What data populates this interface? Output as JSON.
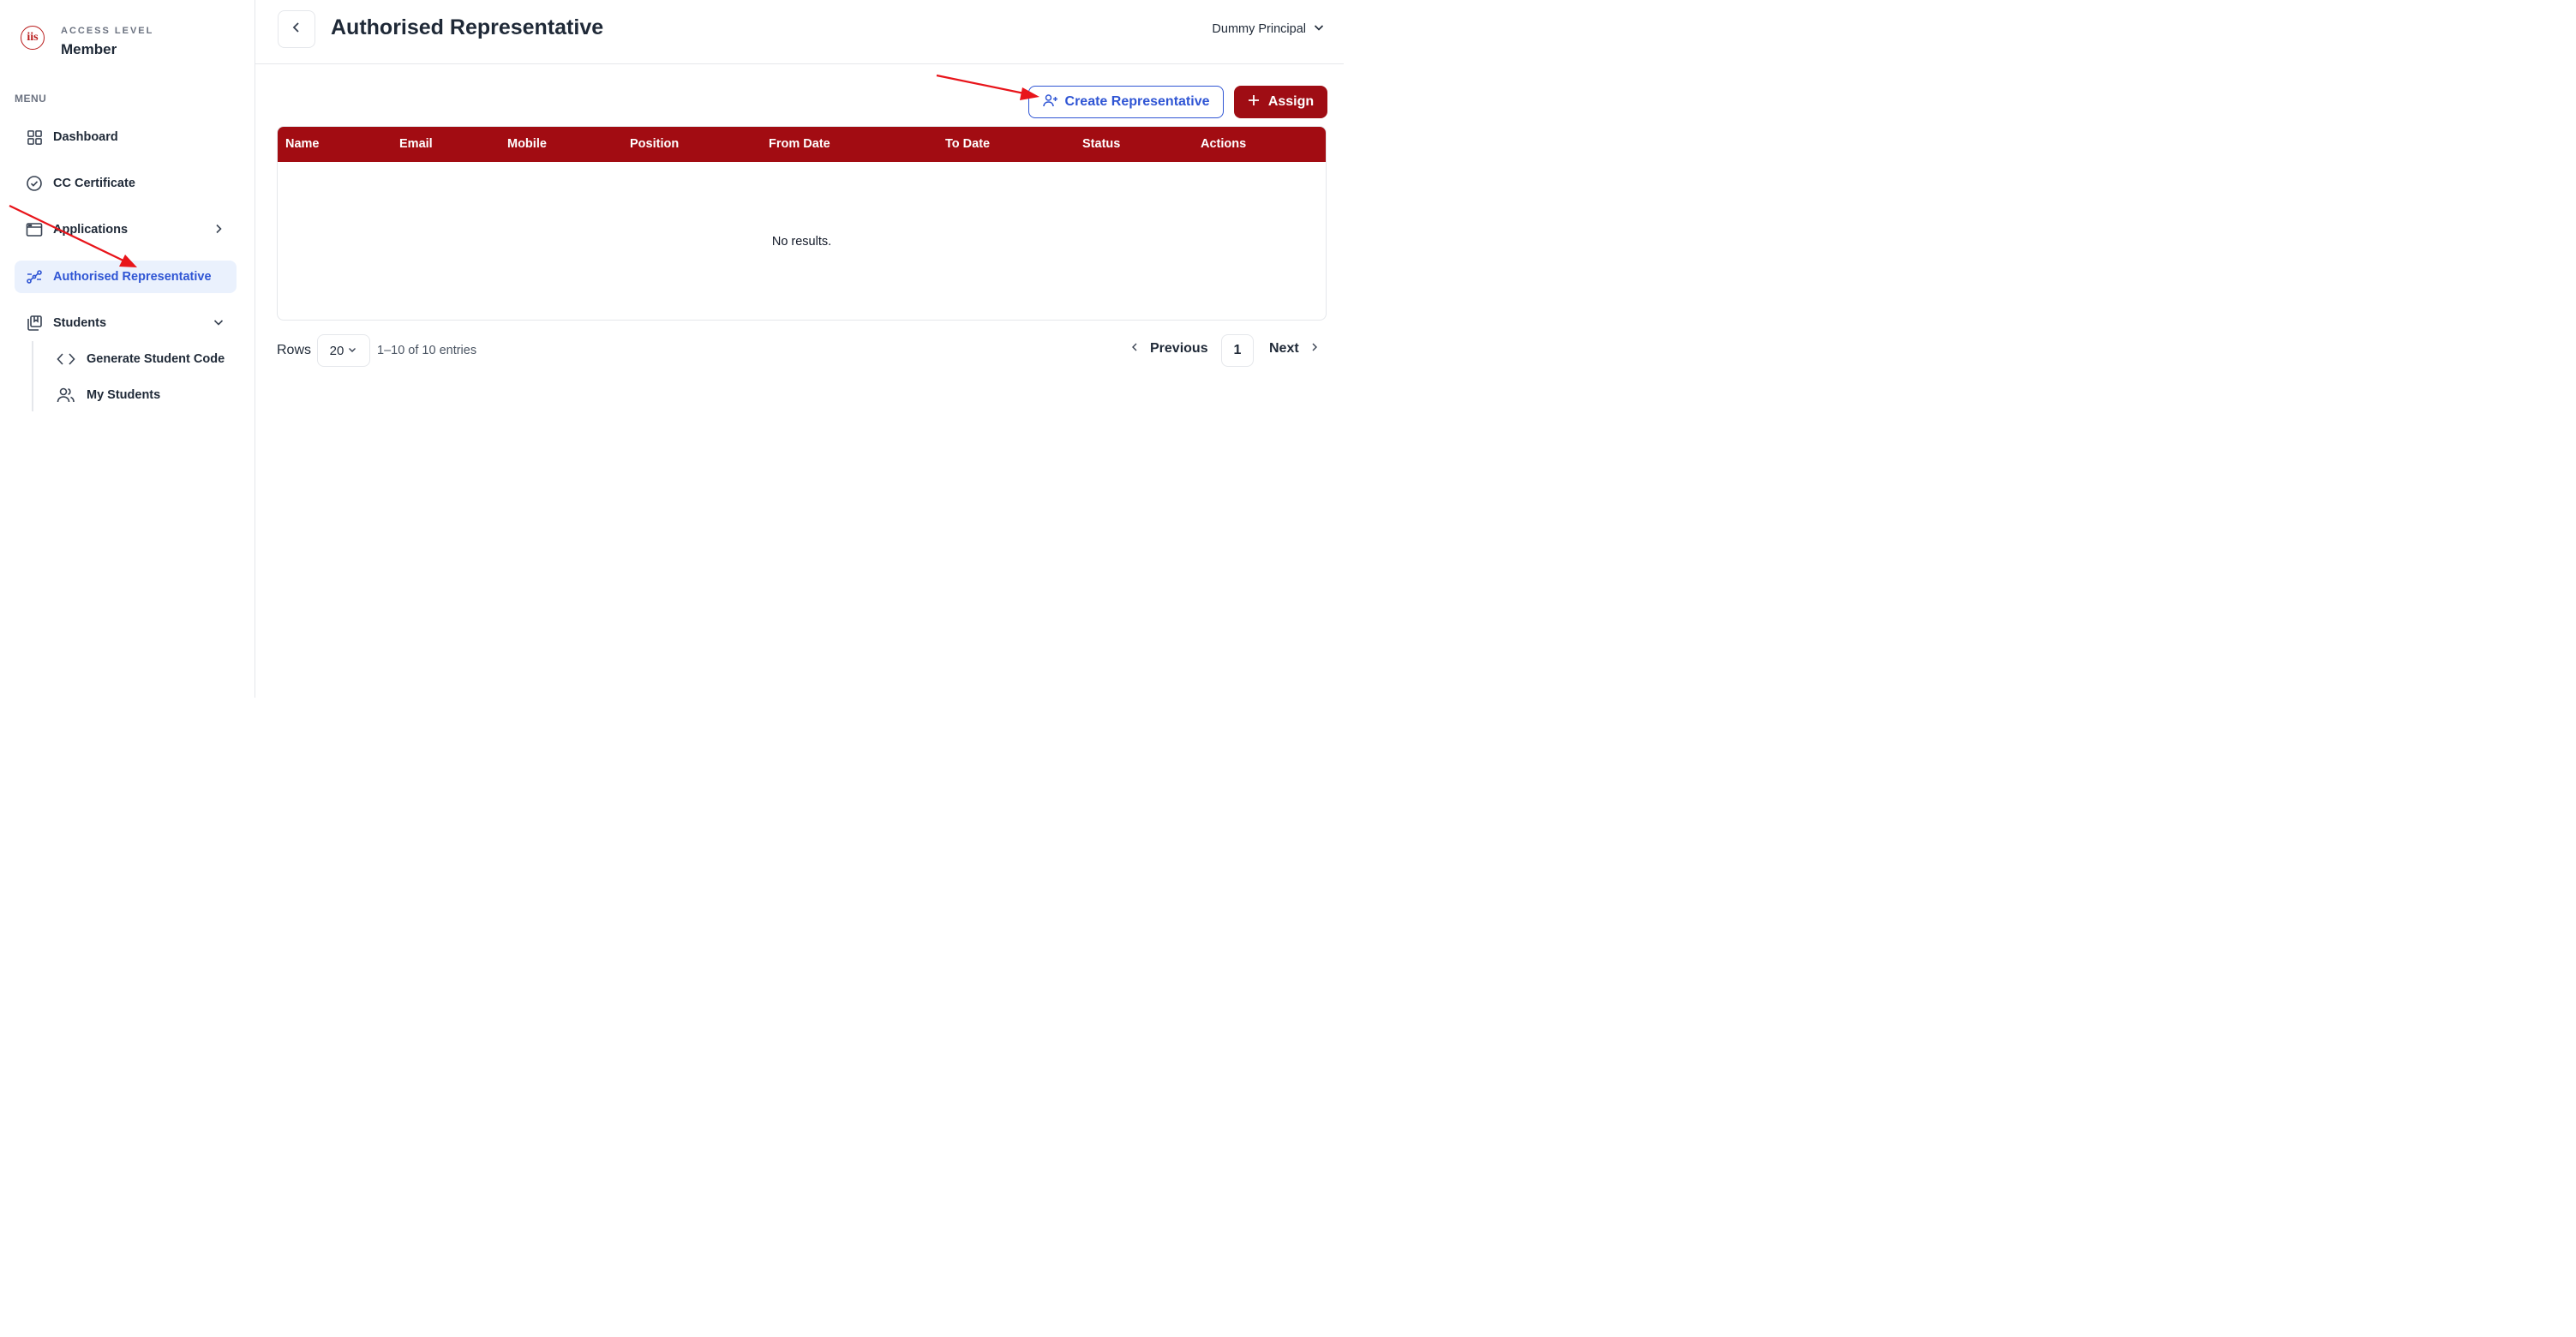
{
  "brand": {
    "logo_text": "iis"
  },
  "access": {
    "label": "ACCESS LEVEL",
    "value": "Member"
  },
  "menu": {
    "label": "MENU",
    "items": [
      {
        "label": "Dashboard",
        "icon": "grid-icon"
      },
      {
        "label": "CC Certificate",
        "icon": "badge-check-icon"
      },
      {
        "label": "Applications",
        "icon": "window-icon"
      },
      {
        "label": "Authorised Representative",
        "icon": "route-icon",
        "active": true
      },
      {
        "label": "Students",
        "icon": "library-icon"
      }
    ],
    "sub_items": [
      {
        "label": "Generate Student Code",
        "icon": "code-icon"
      },
      {
        "label": "My Students",
        "icon": "users-icon"
      }
    ]
  },
  "header": {
    "title": "Authorised Representative",
    "user": "Dummy Principal"
  },
  "actions": {
    "create_label": "Create Representative",
    "assign_label": "Assign"
  },
  "table": {
    "columns": [
      "Name",
      "Email",
      "Mobile",
      "Position",
      "From Date",
      "To Date",
      "Status",
      "Actions"
    ],
    "empty_text": "No results."
  },
  "pagination": {
    "rows_label": "Rows",
    "rows_value": "20",
    "entries_text": "1–10 of 10 entries",
    "previous_label": "Previous",
    "page": "1",
    "next_label": "Next"
  },
  "colors": {
    "primary_red": "#a20c12",
    "accent_blue": "#2f55d4",
    "annotation_red": "#e8141a"
  }
}
